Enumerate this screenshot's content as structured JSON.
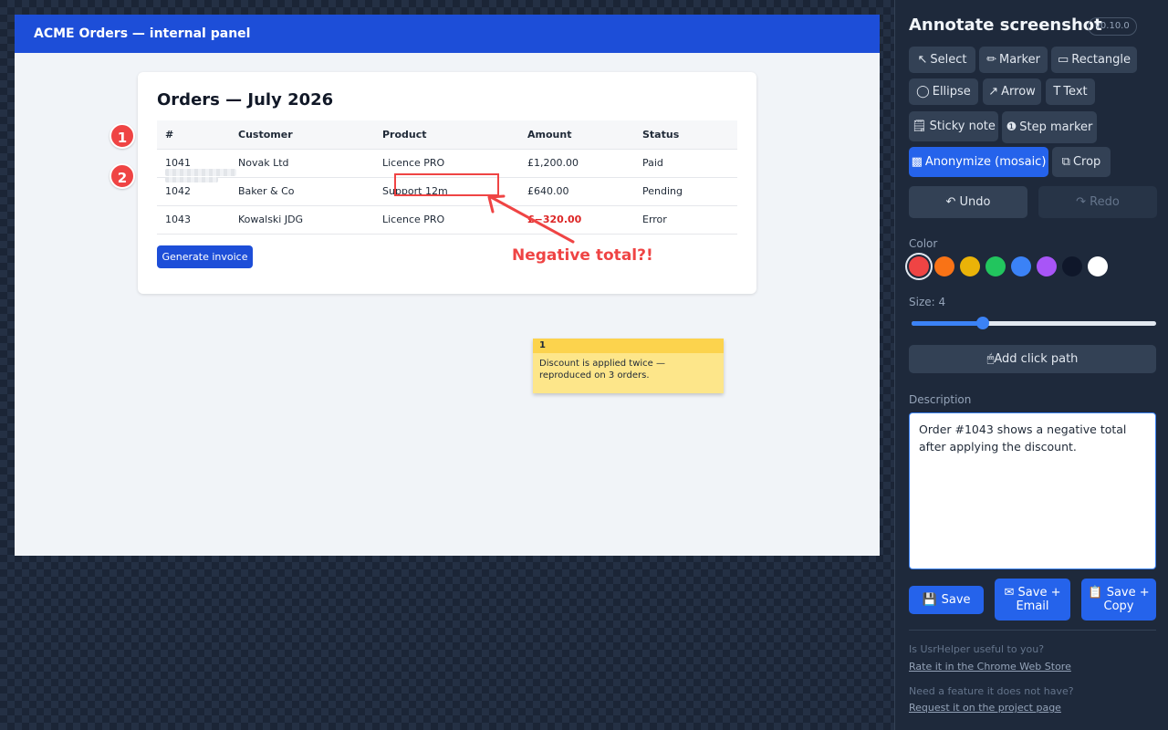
{
  "screenshot": {
    "header_title": "ACME Orders — internal panel",
    "card_title": "Orders — July 2026",
    "table": {
      "columns": [
        "#",
        "Customer",
        "Product",
        "Amount",
        "Status"
      ],
      "rows": [
        [
          "1041",
          "Novak Ltd",
          "Licence PRO",
          "£1,200.00",
          "Paid"
        ],
        [
          "1042",
          "Baker & Co",
          "Support 12m",
          "£640.00",
          "Pending"
        ],
        [
          "1043",
          "Kowalski JDG",
          "Licence PRO",
          "£−320.00",
          "Error"
        ]
      ]
    },
    "generate_invoice_label": "Generate invoice"
  },
  "annotations": {
    "step_markers": [
      "1",
      "2"
    ],
    "arrow_text": "Negative total?!",
    "arrow_color": "#ef4444",
    "sticky_note": {
      "number": "1",
      "text": "Discount is applied twice — reproduced on 3 orders."
    }
  },
  "panel": {
    "title": "Annotate screenshot",
    "version": "v0.10.0",
    "tools": [
      {
        "icon": "↖",
        "label": "Select"
      },
      {
        "icon": "✏",
        "label": "Marker"
      },
      {
        "icon": "▭",
        "label": "Rectangle"
      },
      {
        "icon": "◯",
        "label": "Ellipse"
      },
      {
        "icon": "↗",
        "label": "Arrow"
      },
      {
        "icon": "T",
        "label": "Text"
      },
      {
        "icon": "🗒",
        "label": "Sticky note"
      },
      {
        "icon": "❶",
        "label": "Step marker"
      },
      {
        "icon": "▩",
        "label": "Anonymize (mosaic)"
      },
      {
        "icon": "⧉",
        "label": "Crop"
      }
    ],
    "active_tool": "Anonymize (mosaic)",
    "undo_label": "↶ Undo",
    "redo_label": "↷ Redo",
    "color_label": "Color",
    "colors": [
      "#ef4444",
      "#f97316",
      "#eab308",
      "#22c55e",
      "#3b82f6",
      "#a855f7",
      "#0f172a",
      "#ffffff"
    ],
    "selected_color": "#ef4444",
    "size_label": "Size: 4",
    "size_value_fraction": 0.29,
    "add_click_path_label": "🖱Add click path",
    "description_label": "Description",
    "description_value": "Order #1043 shows a negative total after applying the discount.",
    "save_buttons": [
      {
        "icon": "💾",
        "label": "Save"
      },
      {
        "icon": "✉",
        "label": "Save + Email"
      },
      {
        "icon": "📋",
        "label": "Save + Copy"
      }
    ],
    "footer": {
      "question_1": "Is UsrHelper useful to you?",
      "link_1": "Rate it in the Chrome Web Store",
      "question_2": "Need a feature it does not have?",
      "link_2": "Request it on the project page"
    }
  }
}
